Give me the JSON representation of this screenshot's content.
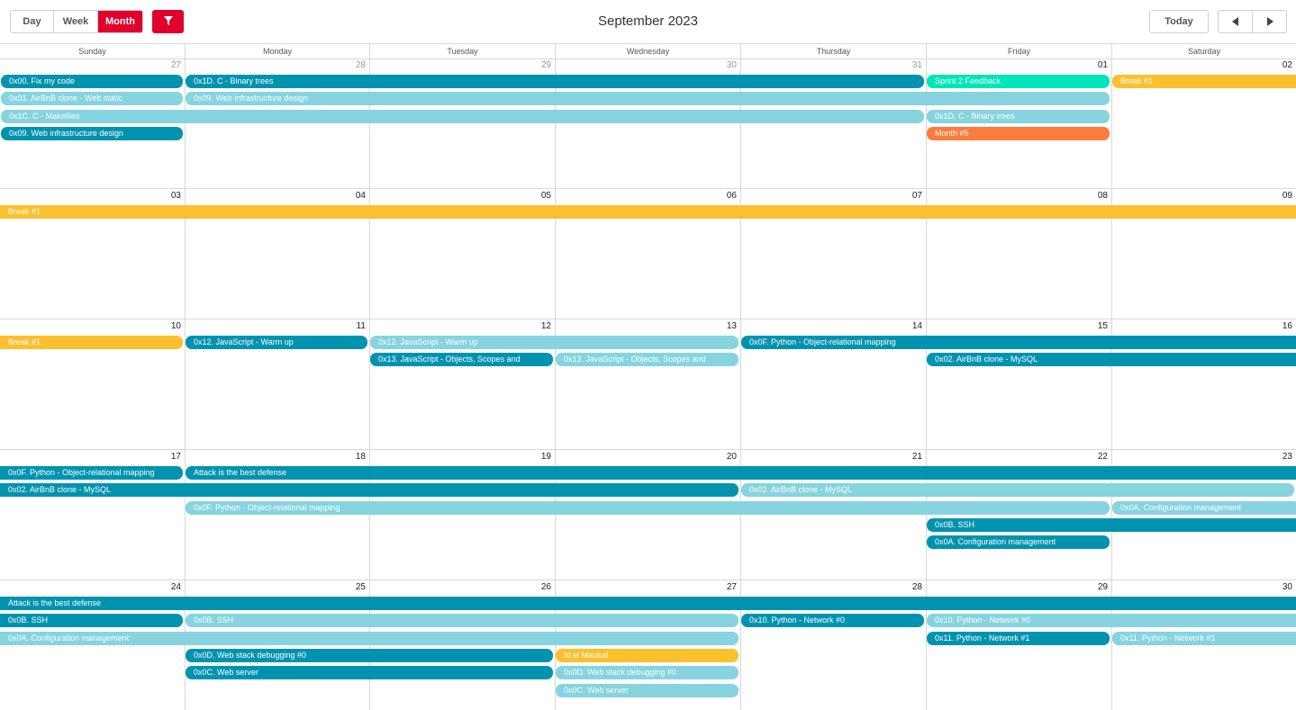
{
  "toolbar": {
    "views": [
      "Day",
      "Week",
      "Month"
    ],
    "active_view": "Month",
    "title": "September 2023",
    "today_label": "Today",
    "filter_icon": "filter-icon",
    "prev_icon": "chevron-left-icon",
    "next_icon": "chevron-right-icon"
  },
  "colors": {
    "accent": "#e0002b",
    "project_dark": "#0093b0",
    "project_light": "#85d4e0",
    "sprint": "#00e6b8",
    "break": "#fbc02d",
    "month": "#ff7a3d"
  },
  "weekdays": [
    "Sunday",
    "Monday",
    "Tuesday",
    "Wednesday",
    "Thursday",
    "Friday",
    "Saturday"
  ],
  "weeks": [
    {
      "days": [
        {
          "num": "27",
          "other": true
        },
        {
          "num": "28",
          "other": true
        },
        {
          "num": "29",
          "other": true
        },
        {
          "num": "30",
          "other": true
        },
        {
          "num": "31",
          "other": true
        },
        {
          "num": "01",
          "other": false
        },
        {
          "num": "02",
          "other": false
        }
      ],
      "events": [
        {
          "title": "0x00. Fix my code",
          "start": 0,
          "span": 1,
          "row": 0,
          "color": "dark"
        },
        {
          "title": "0x1D. C - Binary trees",
          "start": 1,
          "span": 4,
          "row": 0,
          "color": "dark"
        },
        {
          "title": "Sprint 2 Feedback",
          "start": 5,
          "span": 1,
          "row": 0,
          "color": "sprint"
        },
        {
          "title": "Break #1",
          "start": 6,
          "span": 1,
          "row": 0,
          "color": "break",
          "open_right": true
        },
        {
          "title": "0x01. AirBnB clone - Web static",
          "start": 0,
          "span": 1,
          "row": 1,
          "color": "light"
        },
        {
          "title": "0x09. Web infrastructure design",
          "start": 1,
          "span": 5,
          "row": 1,
          "color": "light"
        },
        {
          "title": "0x1C. C - Makefiles",
          "start": 0,
          "span": 5,
          "row": 2,
          "color": "light"
        },
        {
          "title": "0x1D. C - Binary trees",
          "start": 5,
          "span": 1,
          "row": 2,
          "color": "light"
        },
        {
          "title": "0x09. Web infrastructure design",
          "start": 0,
          "span": 1,
          "row": 3,
          "color": "dark"
        },
        {
          "title": "Month #5",
          "start": 5,
          "span": 1,
          "row": 3,
          "color": "month"
        }
      ]
    },
    {
      "days": [
        {
          "num": "03",
          "other": false
        },
        {
          "num": "04",
          "other": false
        },
        {
          "num": "05",
          "other": false
        },
        {
          "num": "06",
          "other": false
        },
        {
          "num": "07",
          "other": false
        },
        {
          "num": "08",
          "other": false
        },
        {
          "num": "09",
          "other": false
        }
      ],
      "events": [
        {
          "title": "Break #1",
          "start": 0,
          "span": 7,
          "row": 0,
          "color": "break",
          "open_left": true,
          "open_right": true
        }
      ]
    },
    {
      "days": [
        {
          "num": "10",
          "other": false
        },
        {
          "num": "11",
          "other": false
        },
        {
          "num": "12",
          "other": false
        },
        {
          "num": "13",
          "other": false
        },
        {
          "num": "14",
          "other": false
        },
        {
          "num": "15",
          "other": false
        },
        {
          "num": "16",
          "other": false
        }
      ],
      "events": [
        {
          "title": "Break #1",
          "start": 0,
          "span": 1,
          "row": 0,
          "color": "break",
          "open_left": true
        },
        {
          "title": "0x12. JavaScript - Warm up",
          "start": 1,
          "span": 1,
          "row": 0,
          "color": "dark"
        },
        {
          "title": "0x12. JavaScript - Warm up",
          "start": 2,
          "span": 2,
          "row": 0,
          "color": "light"
        },
        {
          "title": "0x0F. Python - Object-relational mapping",
          "start": 4,
          "span": 3,
          "row": 0,
          "color": "dark",
          "open_right": true
        },
        {
          "title": "0x13. JavaScript - Objects, Scopes and",
          "start": 2,
          "span": 1,
          "row": 1,
          "color": "dark"
        },
        {
          "title": "0x13. JavaScript - Objects, Scopes and",
          "start": 3,
          "span": 1,
          "row": 1,
          "color": "light"
        },
        {
          "title": "0x02. AirBnB clone - MySQL",
          "start": 5,
          "span": 2,
          "row": 1,
          "color": "dark",
          "open_right": true
        }
      ]
    },
    {
      "days": [
        {
          "num": "17",
          "other": false
        },
        {
          "num": "18",
          "other": false
        },
        {
          "num": "19",
          "other": false
        },
        {
          "num": "20",
          "other": false
        },
        {
          "num": "21",
          "other": false
        },
        {
          "num": "22",
          "other": false
        },
        {
          "num": "23",
          "other": false
        }
      ],
      "events": [
        {
          "title": "0x0F. Python - Object-relational mapping",
          "start": 0,
          "span": 1,
          "row": 0,
          "color": "dark",
          "open_left": true
        },
        {
          "title": "Attack is the best defense",
          "start": 1,
          "span": 6,
          "row": 0,
          "color": "dark",
          "open_right": true
        },
        {
          "title": "0x02. AirBnB clone - MySQL",
          "start": 0,
          "span": 4,
          "row": 1,
          "color": "dark",
          "open_left": true
        },
        {
          "title": "0x02. AirBnB clone - MySQL",
          "start": 4,
          "span": 3,
          "row": 1,
          "color": "light"
        },
        {
          "title": "0x0F. Python - Object-relational mapping",
          "start": 1,
          "span": 5,
          "row": 2,
          "color": "light"
        },
        {
          "title": "0x0A. Configuration management",
          "start": 6,
          "span": 1,
          "row": 2,
          "color": "light",
          "open_right": true
        },
        {
          "title": "0x0B. SSH",
          "start": 5,
          "span": 2,
          "row": 3,
          "color": "dark",
          "open_right": true
        },
        {
          "title": "0x0A. Configuration management",
          "start": 5,
          "span": 1,
          "row": 4,
          "color": "dark"
        }
      ]
    },
    {
      "days": [
        {
          "num": "24",
          "other": false
        },
        {
          "num": "25",
          "other": false
        },
        {
          "num": "26",
          "other": false
        },
        {
          "num": "27",
          "other": false
        },
        {
          "num": "28",
          "other": false
        },
        {
          "num": "29",
          "other": false
        },
        {
          "num": "30",
          "other": false
        }
      ],
      "events": [
        {
          "title": "Attack is the best defense",
          "start": 0,
          "span": 7,
          "row": 0,
          "color": "dark",
          "open_left": true,
          "open_right": true
        },
        {
          "title": "0x0B. SSH",
          "start": 0,
          "span": 1,
          "row": 1,
          "color": "dark",
          "open_left": true
        },
        {
          "title": "0x0B. SSH",
          "start": 1,
          "span": 3,
          "row": 1,
          "color": "light"
        },
        {
          "title": "0x10. Python - Network #0",
          "start": 4,
          "span": 1,
          "row": 1,
          "color": "dark"
        },
        {
          "title": "0x10. Python - Network #0",
          "start": 5,
          "span": 2,
          "row": 1,
          "color": "light",
          "open_right": true
        },
        {
          "title": "0x0A. Configuration management",
          "start": 0,
          "span": 4,
          "row": 2,
          "color": "light",
          "open_left": true
        },
        {
          "title": "0x11. Python - Network #1",
          "start": 5,
          "span": 1,
          "row": 2,
          "color": "dark"
        },
        {
          "title": "0x11. Python - Network #1",
          "start": 6,
          "span": 1,
          "row": 2,
          "color": "light",
          "open_right": true
        },
        {
          "title": "0x0D. Web stack debugging #0",
          "start": 1,
          "span": 2,
          "row": 3,
          "color": "dark"
        },
        {
          "title": "Id el Maulud",
          "start": 3,
          "span": 1,
          "row": 3,
          "color": "break"
        },
        {
          "title": "0x0C. Web server",
          "start": 1,
          "span": 2,
          "row": 4,
          "color": "dark"
        },
        {
          "title": "0x0D. Web stack debugging #0",
          "start": 3,
          "span": 1,
          "row": 4,
          "color": "light"
        },
        {
          "title": "0x0C. Web server",
          "start": 3,
          "span": 1,
          "row": 5,
          "color": "light"
        }
      ]
    }
  ]
}
